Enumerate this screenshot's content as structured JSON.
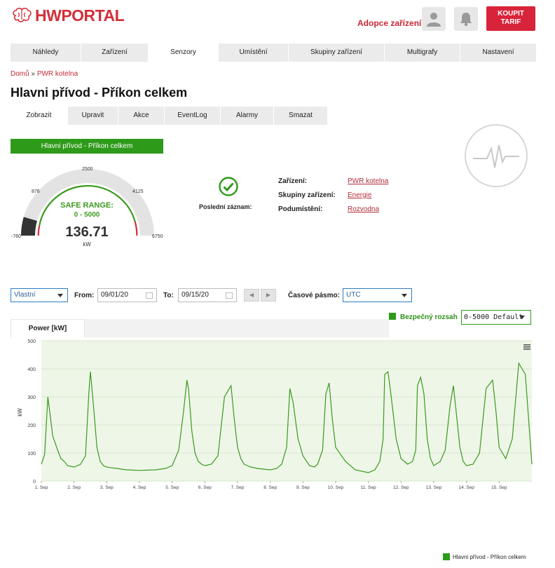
{
  "header": {
    "logo_hw": "HW",
    "logo_portal": "PORTAL",
    "adopce_link": "Adopce zařízení",
    "buy_button_line1": "KOUPIT",
    "buy_button_line2": "TARIF",
    "user_icon": "user-icon",
    "bell_icon": "bell-icon"
  },
  "main_nav": {
    "items": [
      "Náhledy",
      "Zařízení",
      "Senzory",
      "Umístění",
      "Skupiny zařízení",
      "Multigrafy",
      "Nastavení"
    ],
    "active": "Senzory"
  },
  "breadcrumb": {
    "home": "Domů",
    "separator": "»",
    "current": "PWR kotelna"
  },
  "page_title": "Hlavni přívod - Příkon celkem",
  "sub_tabs": {
    "items": [
      "Zobrazit",
      "Upravit",
      "Akce",
      "EventLog",
      "Alarmy",
      "Smazat"
    ],
    "active": "Zobrazit"
  },
  "sensor_name_bar": "Hlavni přívod - Příkon celkem",
  "gauge": {
    "min_label": "-760",
    "label_876": "876",
    "label_2500": "2500",
    "label_4125": "4125",
    "max_label": "6750",
    "safe_range_title": "SAFE RANGE:",
    "safe_range_value": "0 - 5000",
    "value": "136.71",
    "unit": "kW",
    "min": -760,
    "max": 6750,
    "current": 136.71,
    "safe_min": 0,
    "safe_max": 5000
  },
  "status": {
    "last_record_label": "Poslední záznam:",
    "icon": "check-circle-icon"
  },
  "info": {
    "device_label": "Zařízení:",
    "device_value": "PWR kotelna",
    "group_label": "Skupiny zařízení:",
    "group_value": "Energie",
    "sublocation_label": "Podumístění:",
    "sublocation_value": "Rozvodna"
  },
  "controls": {
    "range_select": "Vlastní",
    "from_label": "From:",
    "from_value": "09/01/20",
    "to_label": "To:",
    "to_value": "09/15/20",
    "prev_button": "◀",
    "next_button": "▶",
    "timezone_label": "Časové pásmo:",
    "timezone_value": "UTC",
    "safe_legend": "Bezpečný rozsah",
    "safe_select": "0-5000 Default"
  },
  "chart_tab": "Power [kW]",
  "colors": {
    "accent_red": "#d32f3a",
    "series_green": "#3a9a1e",
    "plot_bg": "#eef6e8"
  },
  "chart_data": {
    "type": "line",
    "ylabel": "kW",
    "ylim": [
      0,
      500
    ],
    "y_ticks": [
      "0",
      "100",
      "200",
      "300",
      "400",
      "500"
    ],
    "x_tick_labels": [
      "1. Sep",
      "2. Sep",
      "3. Sep",
      "4. Sep",
      "5. Sep",
      "6. Sep",
      "7. Sep",
      "8. Sep",
      "9. Sep",
      "10. Sep",
      "11. Sep",
      "12. Sep",
      "13. Sep",
      "14. Sep",
      "15. Sep"
    ],
    "x_range_days": [
      1,
      16
    ],
    "series": [
      {
        "name": "Hlavni přívod - Příkon celkem",
        "x": [
          1.0,
          1.1,
          1.2,
          1.35,
          1.5,
          1.6,
          1.7,
          1.8,
          2.0,
          2.2,
          2.35,
          2.45,
          2.5,
          2.6,
          2.7,
          2.8,
          2.9,
          3.0,
          3.1,
          3.3,
          3.6,
          4.0,
          4.5,
          4.8,
          5.0,
          5.2,
          5.35,
          5.45,
          5.5,
          5.6,
          5.7,
          5.8,
          5.9,
          6.0,
          6.2,
          6.4,
          6.6,
          6.8,
          6.9,
          7.0,
          7.1,
          7.2,
          7.3,
          7.4,
          7.6,
          8.0,
          8.2,
          8.35,
          8.5,
          8.6,
          8.7,
          8.85,
          9.0,
          9.2,
          9.35,
          9.45,
          9.6,
          9.7,
          9.8,
          9.9,
          10.0,
          10.3,
          10.6,
          11.0,
          11.2,
          11.35,
          11.45,
          11.5,
          11.6,
          11.7,
          11.85,
          12.0,
          12.2,
          12.35,
          12.45,
          12.5,
          12.6,
          12.7,
          12.8,
          12.9,
          13.0,
          13.2,
          13.35,
          13.5,
          13.6,
          13.7,
          13.8,
          13.9,
          14.0,
          14.2,
          14.4,
          14.6,
          14.8,
          14.9,
          15.0,
          15.2,
          15.4,
          15.6,
          15.8,
          16.0
        ],
        "values": [
          60,
          95,
          300,
          160,
          110,
          80,
          70,
          55,
          50,
          60,
          90,
          310,
          390,
          260,
          120,
          70,
          55,
          50,
          48,
          45,
          40,
          38,
          40,
          45,
          55,
          110,
          250,
          360,
          330,
          180,
          100,
          70,
          60,
          55,
          60,
          90,
          300,
          340,
          220,
          120,
          80,
          60,
          55,
          50,
          45,
          40,
          45,
          60,
          120,
          330,
          280,
          150,
          90,
          55,
          50,
          60,
          110,
          310,
          350,
          220,
          120,
          70,
          40,
          30,
          40,
          70,
          150,
          380,
          390,
          300,
          150,
          80,
          60,
          70,
          110,
          340,
          370,
          310,
          150,
          80,
          55,
          70,
          110,
          270,
          340,
          230,
          120,
          70,
          55,
          60,
          100,
          330,
          360,
          250,
          120,
          80,
          150,
          420,
          380,
          60
        ]
      }
    ],
    "legend": [
      "Hlavni přívod - Příkon celkem"
    ],
    "legend_position": "bottom-right",
    "grid": true
  }
}
